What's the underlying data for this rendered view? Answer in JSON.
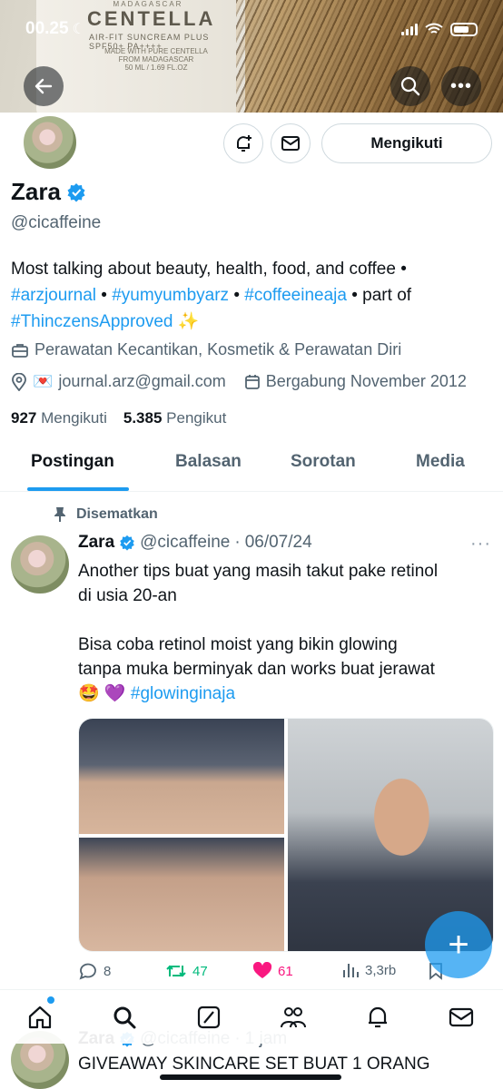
{
  "status_bar": {
    "time": "00.25"
  },
  "banner": {
    "brand_top": "MADAGASCAR",
    "brand": "CENTELLA",
    "product": "AIR-FIT SUNCREAM PLUS",
    "spf": "SPF50+ PA++++",
    "made_with": "MADE WITH PURE CENTELLA FROM MADAGASCAR",
    "volume": "50 ML / 1.69 FL.OZ"
  },
  "profile": {
    "name": "Zara",
    "handle": "@cicaffeine",
    "follow_label": "Mengikuti",
    "bio_text_1": "Most talking about beauty, health, food, and coffee •",
    "bio_tag_1": "#arzjournal",
    "bio_sep_1": " • ",
    "bio_tag_2": "#yumyumbyarz",
    "bio_sep_2": " • ",
    "bio_tag_3": "#coffeeineaja",
    "bio_text_2": " • part of",
    "bio_tag_4": "#ThinczensApproved",
    "bio_emoji": " ✨",
    "category": "Perawatan Kecantikan, Kosmetik & Perawatan Diri",
    "email_emoji": "💌",
    "email": "journal.arz@gmail.com",
    "joined": "Bergabung November 2012",
    "following_count": "927",
    "following_label": "Mengikuti",
    "followers_count": "5.385",
    "followers_label": "Pengikut"
  },
  "tabs": [
    "Postingan",
    "Balasan",
    "Sorotan",
    "Media"
  ],
  "pinned_post": {
    "pinned_label": "Disematkan",
    "author": "Zara",
    "handle": "@cicaffeine",
    "dot": "·",
    "date": "06/07/24",
    "line_1": "Another tips buat yang masih takut pake retinol",
    "line_2": "di usia 20-an",
    "line_3": "Bisa coba retinol moist yang bikin glowing",
    "line_4": "tanpa muka berminyak dan works buat jerawat",
    "emojis": "🤩 💜 ",
    "hashtag": "#glowinginaja",
    "replies": "8",
    "reposts": "47",
    "likes": "61",
    "views": "3,3rb"
  },
  "next_post": {
    "author": "Zara",
    "handle": "@cicaffeine",
    "dot": "·",
    "time": "1 jam",
    "text": "GIVEAWAY SKINCARE SET BUAT 1 ORANG"
  },
  "colors": {
    "accent": "#1d9bf0",
    "repost": "#00ba7c",
    "like": "#f91880",
    "text": "#0f1419",
    "muted": "#536471"
  }
}
